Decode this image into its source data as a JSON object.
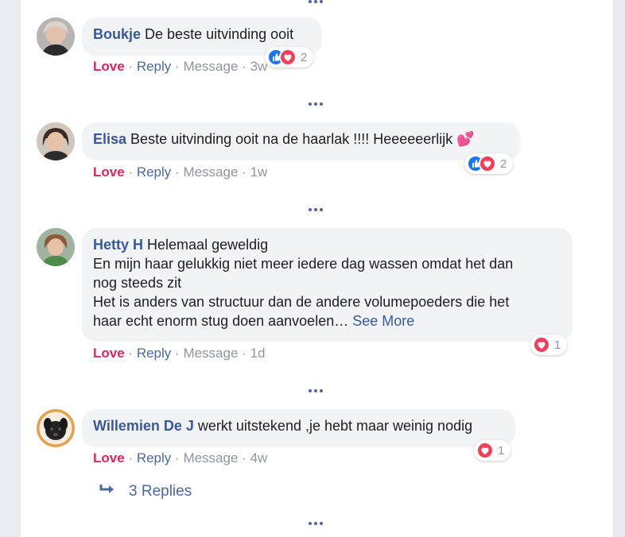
{
  "comments": [
    {
      "author": "Boukje",
      "text": "De beste uitvinding ooit",
      "love": "Love",
      "reply": "Reply",
      "message": "Message",
      "time": "3w",
      "reaction_count": "2",
      "reactions": [
        "like-icon",
        "love-icon"
      ]
    },
    {
      "author": "Elisa",
      "text": "Beste uitvinding ooit na de haarlak !!!! Heeeeeerlijk",
      "emoji": "💕",
      "love": "Love",
      "reply": "Reply",
      "message": "Message",
      "time": "1w",
      "reaction_count": "2",
      "reactions": [
        "like-icon",
        "love-icon"
      ]
    },
    {
      "author": "Hetty H",
      "text": "Helemaal geweldig",
      "line2": "En mijn haar gelukkig niet meer iedere dag wassen omdat het dan",
      "line3": "nog steeds zit",
      "line4": "Het is anders van structuur dan de andere volumepoeders die het",
      "line5": "haar echt enorm stug doen aanvoelen…",
      "see_more": "See More",
      "love": "Love",
      "reply": "Reply",
      "message": "Message",
      "time": "1d",
      "reaction_count": "1",
      "reactions": [
        "love-icon"
      ]
    },
    {
      "author": "Willemien De J",
      "text": "werkt uitstekend ,je hebt maar weinig nodig",
      "love": "Love",
      "reply": "Reply",
      "message": "Message",
      "time": "4w",
      "reaction_count": "1",
      "reactions": [
        "love-icon"
      ]
    }
  ],
  "replies_link": "3 Replies",
  "separator": "·",
  "colors": {
    "link": "#385898",
    "love": "#e0245e",
    "like": "#1877f2",
    "heart": "#f33e58",
    "bubble": "#f2f3f5",
    "meta": "#90949c"
  }
}
